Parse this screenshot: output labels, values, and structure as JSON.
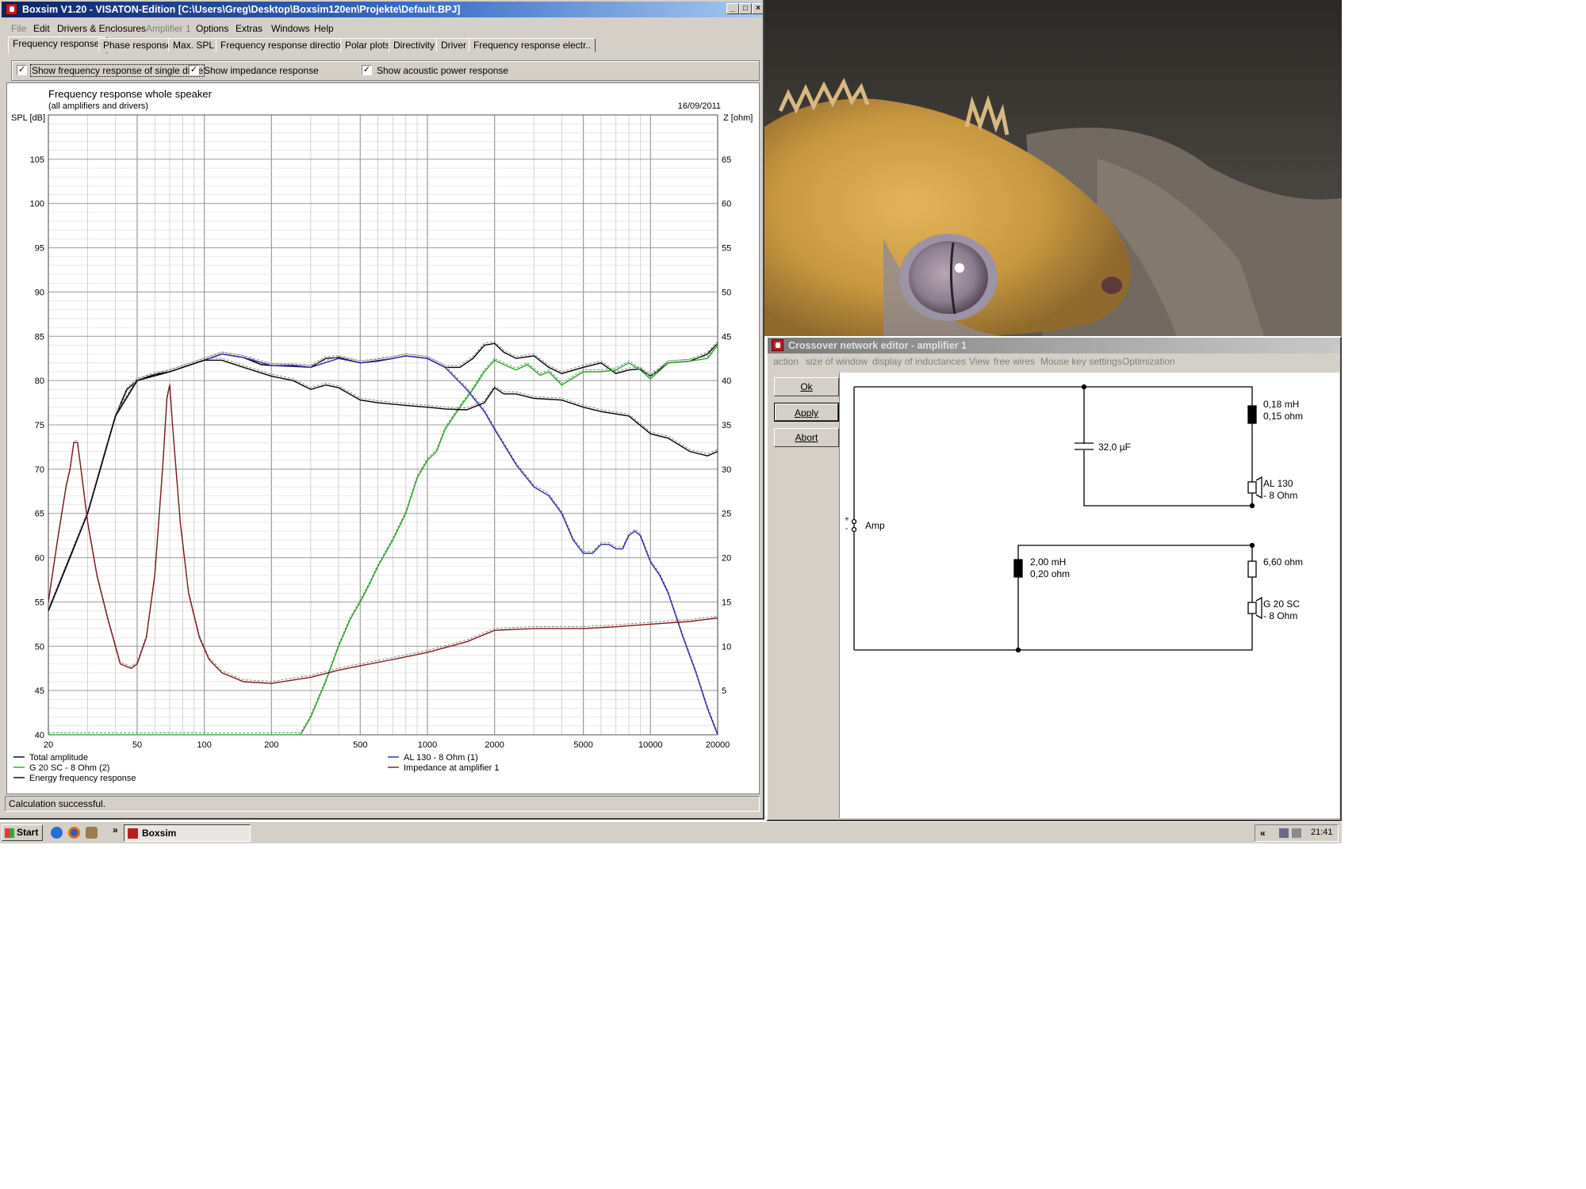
{
  "boxsim": {
    "title": "Boxsim V1.20 - VISATON-Edition [C:\\Users\\Greg\\Desktop\\Boxsim120en\\Projekte\\Default.BPJ]",
    "menu": [
      "File",
      "Edit",
      "Drivers & Enclosures",
      "Amplifier 1",
      "Options",
      "Extras",
      "Windows",
      "Help"
    ],
    "tabs": [
      "Frequency response.",
      "Phase response",
      "Max. SPL",
      "Frequency response directions",
      "Polar plots",
      "Directivity",
      "Driver",
      "Frequency response electr.."
    ],
    "options": {
      "single_drivers": "Show frequency response of single drive",
      "impedance": "Show impedance response",
      "acoustic_power": "Show acoustic power response"
    },
    "status": "Calculation successful."
  },
  "chart_data": {
    "type": "line",
    "title": "Frequency response whole speaker",
    "subtitle": "(all amplifiers and drivers)",
    "date": "16/09/2011",
    "ylabel": "SPL [dB]",
    "y2label": "Z [ohm]",
    "xscale": "log",
    "xlim": [
      20,
      20000
    ],
    "ylim": [
      40,
      110
    ],
    "y2lim": [
      0,
      70
    ],
    "grid": true,
    "legend_position": "bottom",
    "x_ticks": [
      20,
      50,
      100,
      200,
      500,
      1000,
      2000,
      5000,
      10000,
      20000
    ],
    "y_ticks": [
      40,
      45,
      50,
      55,
      60,
      65,
      70,
      75,
      80,
      85,
      90,
      95,
      100,
      105
    ],
    "y2_ticks": [
      5,
      10,
      15,
      20,
      25,
      30,
      35,
      40,
      45,
      50,
      55,
      60,
      65
    ],
    "series": [
      {
        "name": "Total amplitude",
        "color": "#000000",
        "points": [
          [
            20,
            54
          ],
          [
            25,
            60
          ],
          [
            30,
            65
          ],
          [
            35,
            71
          ],
          [
            40,
            76
          ],
          [
            45,
            79
          ],
          [
            50,
            80
          ],
          [
            60,
            80.7
          ],
          [
            70,
            81
          ],
          [
            80,
            81.5
          ],
          [
            100,
            82.3
          ],
          [
            120,
            83
          ],
          [
            150,
            82.6
          ],
          [
            180,
            81.8
          ],
          [
            200,
            81.7
          ],
          [
            250,
            81.7
          ],
          [
            300,
            81.5
          ],
          [
            350,
            82.5
          ],
          [
            400,
            82.6
          ],
          [
            500,
            82
          ],
          [
            600,
            82.2
          ],
          [
            700,
            82.5
          ],
          [
            800,
            82.8
          ],
          [
            1000,
            82.5
          ],
          [
            1200,
            81.5
          ],
          [
            1400,
            81.5
          ],
          [
            1600,
            82.5
          ],
          [
            1800,
            84
          ],
          [
            2000,
            84.2
          ],
          [
            2200,
            83.2
          ],
          [
            2500,
            82.5
          ],
          [
            3000,
            82.8
          ],
          [
            3500,
            81.5
          ],
          [
            4000,
            80.8
          ],
          [
            5000,
            81.5
          ],
          [
            6000,
            82
          ],
          [
            7000,
            80.8
          ],
          [
            8000,
            81.2
          ],
          [
            9000,
            81.3
          ],
          [
            10000,
            80.5
          ],
          [
            12000,
            82
          ],
          [
            15000,
            82.2
          ],
          [
            18000,
            83
          ],
          [
            20000,
            84.2
          ]
        ]
      },
      {
        "name": "G 20 SC - 8 Ohm (2)",
        "color": "#22aa22",
        "points": [
          [
            20,
            40
          ],
          [
            100,
            40
          ],
          [
            200,
            40
          ],
          [
            270,
            40
          ],
          [
            300,
            42
          ],
          [
            350,
            46
          ],
          [
            400,
            50
          ],
          [
            450,
            53
          ],
          [
            500,
            55
          ],
          [
            550,
            57
          ],
          [
            600,
            59
          ],
          [
            700,
            62
          ],
          [
            800,
            65
          ],
          [
            900,
            69
          ],
          [
            1000,
            71
          ],
          [
            1100,
            72
          ],
          [
            1200,
            74.5
          ],
          [
            1400,
            77
          ],
          [
            1600,
            79
          ],
          [
            1800,
            81
          ],
          [
            2000,
            82.3
          ],
          [
            2200,
            81.8
          ],
          [
            2500,
            81.2
          ],
          [
            2800,
            81.8
          ],
          [
            3200,
            80.6
          ],
          [
            3500,
            81
          ],
          [
            4000,
            79.5
          ],
          [
            5000,
            81
          ],
          [
            6000,
            81
          ],
          [
            7000,
            81.2
          ],
          [
            8000,
            82
          ],
          [
            9000,
            81.2
          ],
          [
            10000,
            80.2
          ],
          [
            12000,
            82
          ],
          [
            15000,
            82.2
          ],
          [
            18000,
            82.5
          ],
          [
            20000,
            84
          ]
        ]
      },
      {
        "name": "AL 130 - 8 Ohm (1)",
        "color": "#2a2aaa",
        "points": [
          [
            20,
            54
          ],
          [
            30,
            65
          ],
          [
            40,
            76
          ],
          [
            50,
            80
          ],
          [
            70,
            81
          ],
          [
            100,
            82.3
          ],
          [
            120,
            83
          ],
          [
            150,
            82.6
          ],
          [
            200,
            81.7
          ],
          [
            300,
            81.5
          ],
          [
            400,
            82.5
          ],
          [
            500,
            82
          ],
          [
            700,
            82.5
          ],
          [
            800,
            82.8
          ],
          [
            1000,
            82.5
          ],
          [
            1200,
            81.5
          ],
          [
            1500,
            79
          ],
          [
            1800,
            76.5
          ],
          [
            2000,
            74.5
          ],
          [
            2500,
            70.5
          ],
          [
            3000,
            68
          ],
          [
            3500,
            67
          ],
          [
            4000,
            65
          ],
          [
            4500,
            62
          ],
          [
            5000,
            60.5
          ],
          [
            5500,
            60.5
          ],
          [
            6000,
            61.5
          ],
          [
            6500,
            61.5
          ],
          [
            7000,
            61
          ],
          [
            7500,
            61
          ],
          [
            8000,
            62.5
          ],
          [
            8500,
            63
          ],
          [
            9000,
            62.5
          ],
          [
            10000,
            59.5
          ],
          [
            11000,
            58
          ],
          [
            12000,
            56
          ],
          [
            14000,
            51
          ],
          [
            16000,
            47
          ],
          [
            18000,
            43
          ],
          [
            20000,
            40
          ]
        ]
      },
      {
        "name": "Energy frequency response",
        "color": "#000000",
        "points": [
          [
            20,
            54
          ],
          [
            30,
            65
          ],
          [
            40,
            76
          ],
          [
            50,
            80
          ],
          [
            70,
            81
          ],
          [
            100,
            82.3
          ],
          [
            120,
            82.3
          ],
          [
            150,
            81.5
          ],
          [
            200,
            80.5
          ],
          [
            250,
            80
          ],
          [
            300,
            79
          ],
          [
            350,
            79.5
          ],
          [
            400,
            79.2
          ],
          [
            500,
            77.8
          ],
          [
            600,
            77.5
          ],
          [
            800,
            77.2
          ],
          [
            1000,
            77
          ],
          [
            1200,
            76.8
          ],
          [
            1500,
            76.7
          ],
          [
            1800,
            77.5
          ],
          [
            2000,
            79.2
          ],
          [
            2200,
            78.5
          ],
          [
            2500,
            78.5
          ],
          [
            3000,
            78
          ],
          [
            4000,
            77.8
          ],
          [
            5000,
            77
          ],
          [
            6000,
            76.5
          ],
          [
            8000,
            76
          ],
          [
            10000,
            74
          ],
          [
            12000,
            73.5
          ],
          [
            15000,
            72
          ],
          [
            18000,
            71.5
          ],
          [
            20000,
            72
          ]
        ]
      },
      {
        "name": "Impedance at amplifier 1",
        "color": "#7a1a1a",
        "axis": "right",
        "points": [
          [
            20,
            15
          ],
          [
            22,
            22
          ],
          [
            24,
            28
          ],
          [
            25,
            30
          ],
          [
            26,
            33
          ],
          [
            27,
            33
          ],
          [
            28,
            30
          ],
          [
            30,
            24
          ],
          [
            33,
            18
          ],
          [
            37,
            13
          ],
          [
            42,
            8
          ],
          [
            47,
            7.5
          ],
          [
            50,
            8
          ],
          [
            55,
            11
          ],
          [
            60,
            18
          ],
          [
            65,
            30
          ],
          [
            68,
            38
          ],
          [
            70,
            39.5
          ],
          [
            72,
            35
          ],
          [
            78,
            24
          ],
          [
            85,
            16
          ],
          [
            95,
            11
          ],
          [
            105,
            8.5
          ],
          [
            120,
            7
          ],
          [
            150,
            6
          ],
          [
            200,
            5.8
          ],
          [
            300,
            6.5
          ],
          [
            400,
            7.3
          ],
          [
            500,
            7.8
          ],
          [
            700,
            8.5
          ],
          [
            1000,
            9.3
          ],
          [
            1500,
            10.5
          ],
          [
            2000,
            11.8
          ],
          [
            3000,
            12
          ],
          [
            5000,
            12
          ],
          [
            7000,
            12.2
          ],
          [
            10000,
            12.5
          ],
          [
            15000,
            12.8
          ],
          [
            20000,
            13.2
          ]
        ]
      }
    ]
  },
  "photo": {
    "subject": "crested gecko close-up"
  },
  "crossover": {
    "title": "Crossover network editor - amplifier 1",
    "menu": [
      "action",
      "size of window",
      "display of inductances",
      "View",
      "free wires",
      "Mouse key settings",
      "Optimization"
    ],
    "buttons": [
      "Ok",
      "Apply",
      "Abort"
    ],
    "labels": {
      "amp": "Amp",
      "cap": "32,0 µF",
      "l1a": "0,18 mH",
      "l1b": "0,15 ohm",
      "d1a": "AL 130",
      "d1b": "- 8 Ohm",
      "l2a": "2,00 mH",
      "l2b": "0,20 ohm",
      "r1": "6,60 ohm",
      "d2a": "G 20 SC",
      "d2b": "- 8 Ohm",
      "plus": "+",
      "minus": "-"
    }
  },
  "taskbar": {
    "start": "Start",
    "task": "Boxsim",
    "time": "21:41",
    "chevron": "»",
    "tray_chevron": "«"
  }
}
